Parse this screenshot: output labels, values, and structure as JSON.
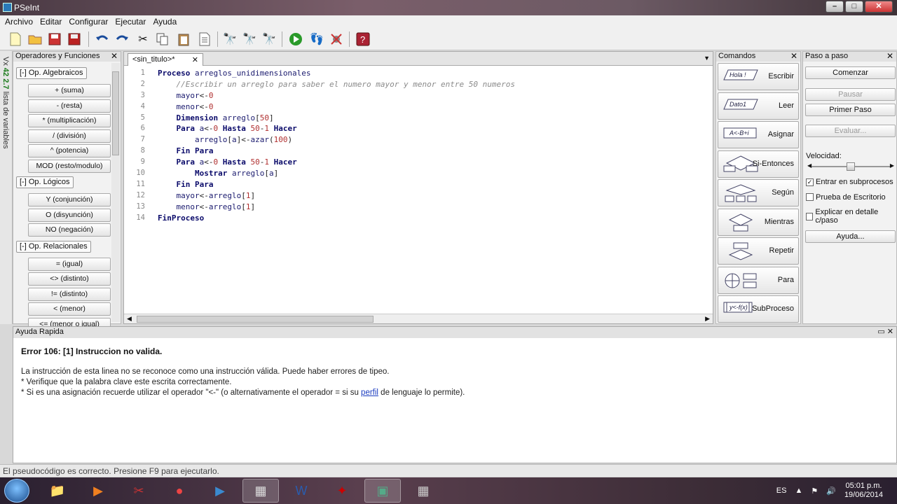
{
  "window": {
    "title": "PSeInt"
  },
  "menu": [
    "Archivo",
    "Editar",
    "Configurar",
    "Ejecutar",
    "Ayuda"
  ],
  "toolbar_icons": [
    "new-file-icon",
    "open-folder-icon",
    "save-icon",
    "save-as-icon",
    "undo-icon",
    "redo-icon",
    "cut-icon",
    "copy-icon",
    "paste-icon",
    "indent-icon",
    "find-icon",
    "find-prev-icon",
    "find-next-icon",
    "run-icon",
    "step-icon",
    "debug-icon",
    "help-icon"
  ],
  "left_strip": {
    "vars": "Vx",
    "ops": "42",
    "ops2": "2.7",
    "label": "lista de variables"
  },
  "ops_panel": {
    "title": "Operadores y Funciones",
    "groups": [
      {
        "label": "[-]  Op. Algebraicos",
        "items": [
          "+ (suma)",
          "- (resta)",
          "* (multiplicación)",
          "/ (división)",
          "^ (potencia)",
          "MOD (resto/modulo)"
        ]
      },
      {
        "label": "[-]  Op. Lógicos",
        "items": [
          "Y (conjunción)",
          "O (disyunción)",
          "NO (negación)"
        ]
      },
      {
        "label": "[-]  Op. Relacionales",
        "items": [
          "= (igual)",
          "<> (distinto)",
          "!= (distinto)",
          "< (menor)",
          "<= (menor o igual)"
        ]
      }
    ]
  },
  "editor": {
    "tab": "<sin_titulo>*",
    "lines": [
      {
        "n": "1",
        "parts": [
          [
            "kw",
            "Proceso "
          ],
          [
            "var",
            "arreglos_unidimensionales"
          ]
        ]
      },
      {
        "n": "2",
        "parts": [
          [
            "plain",
            "    "
          ],
          [
            "cm",
            "//Escribir un arreglo para saber el numero mayor y menor entre 50 numeros"
          ]
        ]
      },
      {
        "n": "3",
        "parts": [
          [
            "plain",
            "    "
          ],
          [
            "var",
            "mayor"
          ],
          [
            "plain",
            "<-"
          ],
          [
            "num",
            "0"
          ]
        ]
      },
      {
        "n": "4",
        "parts": [
          [
            "plain",
            "    "
          ],
          [
            "var",
            "menor"
          ],
          [
            "plain",
            "<-"
          ],
          [
            "num",
            "0"
          ]
        ]
      },
      {
        "n": "5",
        "parts": [
          [
            "plain",
            "    "
          ],
          [
            "kw",
            "Dimension "
          ],
          [
            "var",
            "arreglo"
          ],
          [
            "plain",
            "["
          ],
          [
            "num",
            "50"
          ],
          [
            "plain",
            "]"
          ]
        ]
      },
      {
        "n": "6",
        "parts": [
          [
            "plain",
            "    "
          ],
          [
            "kw",
            "Para "
          ],
          [
            "var",
            "a"
          ],
          [
            "plain",
            "<-"
          ],
          [
            "num",
            "0 "
          ],
          [
            "kw",
            "Hasta "
          ],
          [
            "num",
            "50"
          ],
          [
            "plain",
            "-"
          ],
          [
            "num",
            "1 "
          ],
          [
            "kw",
            "Hacer"
          ]
        ]
      },
      {
        "n": "7",
        "parts": [
          [
            "plain",
            "        "
          ],
          [
            "var",
            "arreglo"
          ],
          [
            "plain",
            "["
          ],
          [
            "var",
            "a"
          ],
          [
            "plain",
            "]<-"
          ],
          [
            "var",
            "azar"
          ],
          [
            "plain",
            "("
          ],
          [
            "num",
            "100"
          ],
          [
            "plain",
            ")"
          ]
        ]
      },
      {
        "n": "8",
        "parts": [
          [
            "plain",
            "    "
          ],
          [
            "kw",
            "Fin Para"
          ]
        ]
      },
      {
        "n": "9",
        "parts": [
          [
            "plain",
            "    "
          ],
          [
            "kw",
            "Para "
          ],
          [
            "var",
            "a"
          ],
          [
            "plain",
            "<-"
          ],
          [
            "num",
            "0 "
          ],
          [
            "kw",
            "Hasta "
          ],
          [
            "num",
            "50"
          ],
          [
            "plain",
            "-"
          ],
          [
            "num",
            "1 "
          ],
          [
            "kw",
            "Hacer"
          ]
        ]
      },
      {
        "n": "10",
        "parts": [
          [
            "plain",
            "        "
          ],
          [
            "kw",
            "Mostrar "
          ],
          [
            "var",
            "arreglo"
          ],
          [
            "plain",
            "["
          ],
          [
            "var",
            "a"
          ],
          [
            "plain",
            "]"
          ]
        ]
      },
      {
        "n": "11",
        "parts": [
          [
            "plain",
            "    "
          ],
          [
            "kw",
            "Fin Para"
          ]
        ]
      },
      {
        "n": "12",
        "parts": [
          [
            "plain",
            "    "
          ],
          [
            "var",
            "mayor"
          ],
          [
            "plain",
            "<-"
          ],
          [
            "var",
            "arreglo"
          ],
          [
            "plain",
            "["
          ],
          [
            "num",
            "1"
          ],
          [
            "plain",
            "]"
          ]
        ]
      },
      {
        "n": "13",
        "parts": [
          [
            "plain",
            "    "
          ],
          [
            "var",
            "menor"
          ],
          [
            "plain",
            "<-"
          ],
          [
            "var",
            "arreglo"
          ],
          [
            "plain",
            "["
          ],
          [
            "num",
            "1"
          ],
          [
            "plain",
            "]"
          ]
        ]
      },
      {
        "n": "14",
        "parts": [
          [
            "kw",
            "FinProceso"
          ]
        ]
      }
    ]
  },
  "commands_panel": {
    "title": "Comandos",
    "items": [
      {
        "label": "Escribir",
        "icon": "Hola !"
      },
      {
        "label": "Leer",
        "icon": "Dato1"
      },
      {
        "label": "Asignar",
        "icon": "A<-B+i"
      },
      {
        "label": "Si-Entonces",
        "icon": ""
      },
      {
        "label": "Según",
        "icon": ""
      },
      {
        "label": "Mientras",
        "icon": ""
      },
      {
        "label": "Repetir",
        "icon": ""
      },
      {
        "label": "Para",
        "icon": ""
      },
      {
        "label": "SubProceso",
        "icon": "y<-f(x)"
      }
    ]
  },
  "step_panel": {
    "title": "Paso a paso",
    "start": "Comenzar",
    "pause": "Pausar",
    "first_step": "Primer Paso",
    "evaluate": "Evaluar...",
    "speed_label": "Velocidad:",
    "speed_level": 0.5,
    "checks": [
      {
        "label": "Entrar en subprocesos",
        "checked": true
      },
      {
        "label": "Prueba de Escritorio",
        "checked": false
      },
      {
        "label": "Explicar en detalle c/paso",
        "checked": false
      }
    ],
    "help": "Ayuda..."
  },
  "help_panel": {
    "title": "Ayuda Rapida",
    "error_title": "Error 106: [1] Instruccion no valida.",
    "line1": "La instrucción de esta linea no se reconoce como una instrucción válida. Puede haber errores de tipeo.",
    "line2": "* Verifique que la palabra clave este escrita correctamente.",
    "line3_pre": "* Si es una asignación recuerde utilizar el operador \"<-\" (o alternativamente el operador = si su ",
    "line3_link": "perfil",
    "line3_post": " de lenguaje lo permite)."
  },
  "status": "El pseudocódigo es correcto. Presione F9 para ejecutarlo.",
  "taskbar": {
    "apps": [
      "explorer-icon",
      "media-player-icon",
      "snipping-icon",
      "chrome-icon",
      "video-player-icon",
      "pseint-icon",
      "word-icon",
      "acrobat-icon",
      "terminal-icon",
      "pseint-run-icon"
    ],
    "lang": "ES",
    "time": "05:01 p.m.",
    "date": "19/06/2014"
  }
}
